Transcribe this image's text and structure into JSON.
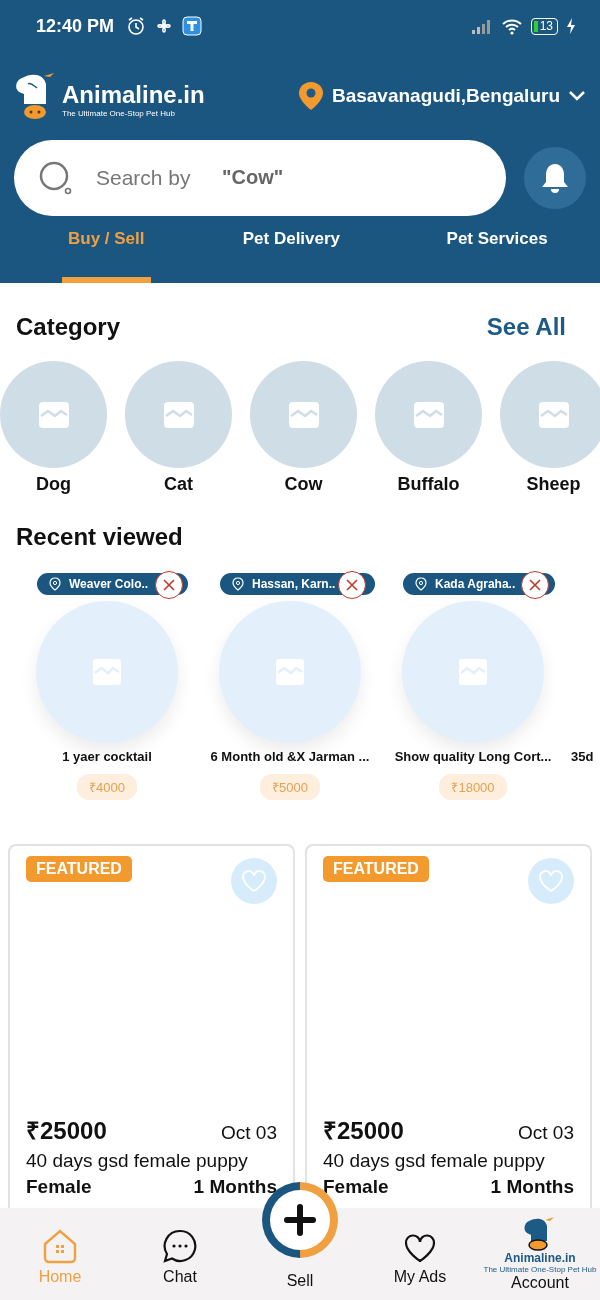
{
  "status_bar": {
    "time": "12:40 PM",
    "battery": "13"
  },
  "header": {
    "logo": {
      "name": "Animaline.in",
      "tagline": "The Ultimate One-Stop Pet Hub"
    },
    "location": "Basavanagudi,Bengaluru",
    "search": {
      "placeholder": "Search by",
      "hint": "\"Cow\""
    }
  },
  "tabs": [
    {
      "label": "Buy / Sell",
      "selected": true
    },
    {
      "label": "Pet Delivery",
      "selected": false
    },
    {
      "label": "Pet Services",
      "selected": false
    }
  ],
  "category": {
    "title": "Category",
    "see_all": "See All",
    "items": [
      "Dog",
      "Cat",
      "Cow",
      "Buffalo",
      "Sheep"
    ]
  },
  "recent": {
    "title": "Recent viewed",
    "items": [
      {
        "location": "Weaver Colo..",
        "title": "1 yaer cocktail",
        "price": "₹4000"
      },
      {
        "location": "Hassan, Karn..",
        "title": "6 Month old &X Jarman ...",
        "price": "₹5000"
      },
      {
        "location": "Kada Agraha..",
        "title": "Show quality Long Cort...",
        "price": "₹18000"
      },
      {
        "title": "35d"
      }
    ]
  },
  "listings": [
    {
      "badge": "FEATURED",
      "liked": false,
      "price": "₹25000",
      "date": "Oct 03",
      "title": "40 days gsd female puppy",
      "gender": "Female",
      "age": "1 Months"
    },
    {
      "badge": "FEATURED",
      "liked": false,
      "price": "₹25000",
      "date": "Oct 03",
      "title": "40 days gsd female puppy",
      "gender": "Female",
      "age": "1 Months"
    }
  ],
  "nav": [
    {
      "label": "Home",
      "kind": "home",
      "selected": true
    },
    {
      "label": "Chat",
      "kind": "chat",
      "selected": false
    },
    {
      "label": "Sell",
      "kind": "sell",
      "selected": false
    },
    {
      "label": "My Ads",
      "kind": "ads",
      "selected": false
    },
    {
      "label": "Account",
      "kind": "account",
      "selected": false,
      "logo": {
        "name": "Animaline.in",
        "tagline": "The Ultimate One-Stop Pet Hub"
      }
    }
  ]
}
